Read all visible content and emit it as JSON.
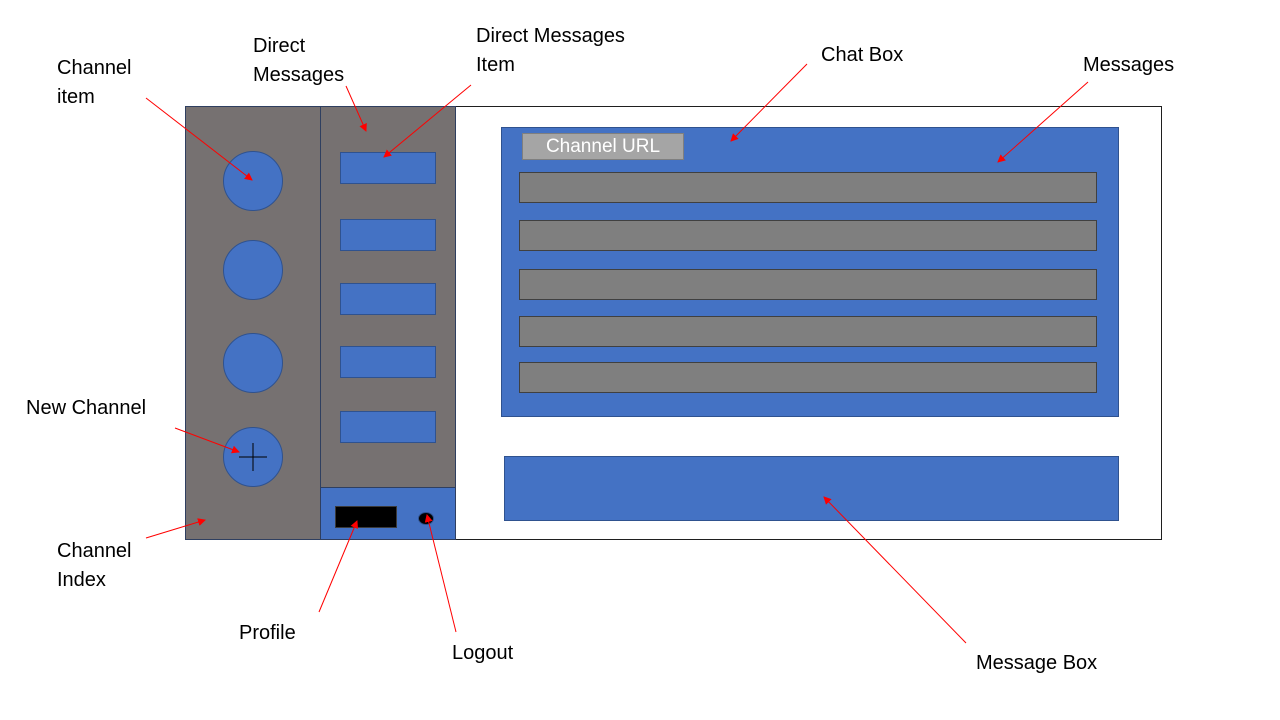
{
  "mockup": {
    "chat_box": {
      "channel_url_label": "Channel URL",
      "message_row_count": 5
    },
    "channel_index": {
      "channel_item_count": 3,
      "new_channel_symbol": "+"
    },
    "direct_messages": {
      "item_count": 5
    }
  },
  "annotations": {
    "channel_item": "Channel\nitem",
    "direct_messages": "Direct\nMessages",
    "direct_messages_item": "Direct Messages\nItem",
    "chat_box": "Chat Box",
    "messages": "Messages",
    "new_channel": "New Channel",
    "channel_index": "Channel\nIndex",
    "profile": "Profile",
    "logout": "Logout",
    "message_box": "Message Box"
  },
  "colors": {
    "panel_gray": "#767171",
    "accent_blue": "#4472c4",
    "message_gray": "#7f7f7f",
    "url_gray": "#a5a5a5",
    "arrow_red": "#ff0000"
  }
}
